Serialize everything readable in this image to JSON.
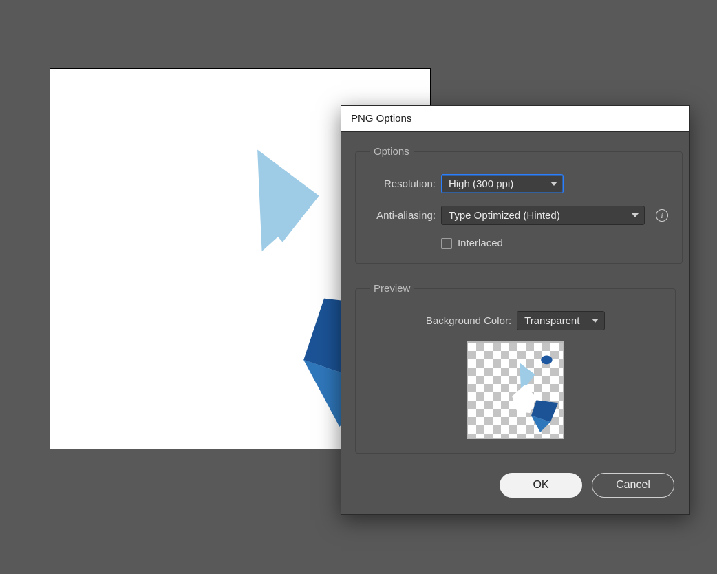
{
  "dialog": {
    "title": "PNG Options",
    "options_group": "Options",
    "resolution_label": "Resolution:",
    "resolution_value": "High (300 ppi)",
    "antialias_label": "Anti-aliasing:",
    "antialias_value": "Type Optimized (Hinted)",
    "interlaced_label": "Interlaced",
    "preview_group": "Preview",
    "bgcolor_label": "Background Color:",
    "bgcolor_value": "Transparent",
    "ok_label": "OK",
    "cancel_label": "Cancel"
  },
  "artwork": {
    "palette": {
      "dark": "#1f5ea8",
      "mid": "#3f86c6",
      "light": "#7fb8de",
      "pale": "#b6d9ed"
    }
  }
}
